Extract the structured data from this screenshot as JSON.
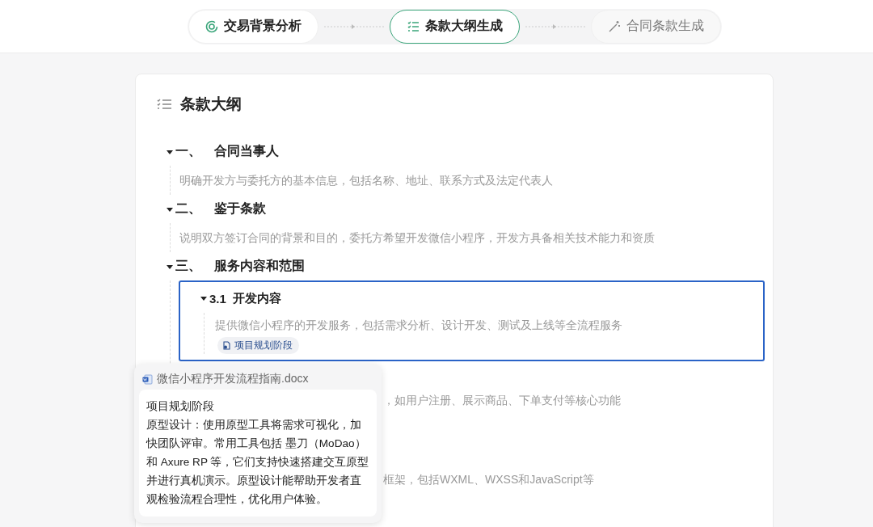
{
  "steps": [
    {
      "label": "交易背景分析",
      "selected": false,
      "disabled": false
    },
    {
      "label": "条款大纲生成",
      "selected": true,
      "disabled": false
    },
    {
      "label": "合同条款生成",
      "selected": false,
      "disabled": true
    }
  ],
  "outline": {
    "title": "条款大纲",
    "sections": [
      {
        "number": "一、",
        "title": "合同当事人",
        "expanded": true,
        "description": "明确开发方与委托方的基本信息，包括名称、地址、联系方式及法定代表人"
      },
      {
        "number": "二、",
        "title": "鉴于条款",
        "expanded": true,
        "description": "说明双方签订合同的背景和目的，委托方希望开发微信小程序，开发方具备相关技术能力和资质"
      },
      {
        "number": "三、",
        "title": "服务内容和范围",
        "expanded": true,
        "children": [
          {
            "kind": "item",
            "number": "3.1",
            "title": "开发内容",
            "expanded": true,
            "selected": true,
            "description": "提供微信小程序的开发服务，包括需求分析、设计开发、测试及上线等全流程服务",
            "references": [
              {
                "label": "项目规划阶段"
              }
            ]
          },
          {
            "kind": "obscured",
            "selected": false,
            "description": "，如用户注册、展示商品、下单支付等核心功能"
          },
          {
            "kind": "obscured",
            "selected": false,
            "description": "框架，包括WXML、WXSS和JavaScript等"
          }
        ]
      }
    ]
  },
  "popover": {
    "file": "微信小程序开发流程指南.docx",
    "title": "项目规划阶段",
    "body": "原型设计：使用原型工具将需求可视化，加快团队评审。常用工具包括 墨刀（MoDao）和 Axure RP 等，它们支持快速搭建交互原型并进行真机演示。原型设计能帮助开发者直观检验流程合理性，优化用户体验。"
  }
}
